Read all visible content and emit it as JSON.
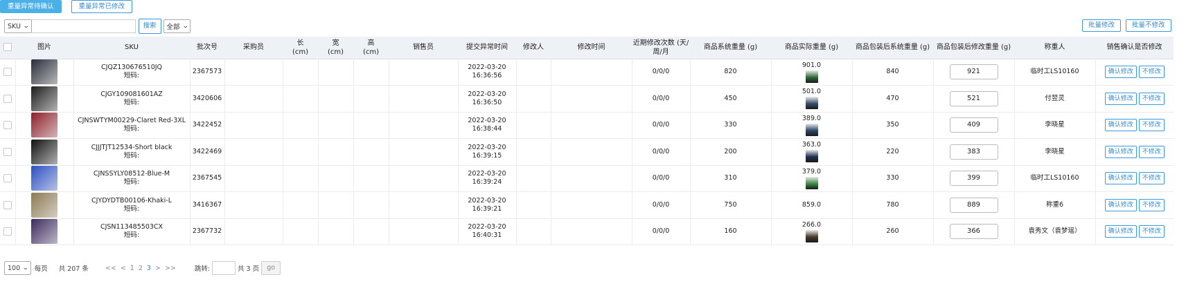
{
  "top_tabs": [
    {
      "label": "重量异常待确认"
    },
    {
      "label": "重量异常已修改"
    }
  ],
  "filter": {
    "field_select": "SKU",
    "search_value": "",
    "search_button": "搜索",
    "scope_select": "全部"
  },
  "batch": {
    "modify_label": "批量修改",
    "no_modify_label": "批量不修改"
  },
  "table": {
    "columns": [
      "",
      "图片",
      "SKU",
      "批次号",
      "采购员",
      "长\n(cm)",
      "宽\n(cm)",
      "高\n(cm)",
      "销售员",
      "提交异常时间",
      "修改人",
      "修改时间",
      "近期修改次数 (天/周/月",
      "商品系统重量 (g)",
      "商品实际重量 (g)",
      "商品包装后系统重量 (g)",
      "商品包装后修改重量 (g)",
      "称重人",
      "销售确认是否修改"
    ],
    "short_code_label": "短码:",
    "confirm_label": "确认修改",
    "reject_label": "不修改",
    "rows": [
      {
        "sku": "CJQZ130676510JQ",
        "batch": "2367573",
        "submit_date": "2022-03-20",
        "submit_time": "16:36:56",
        "recent": "0/0/0",
        "sys_weight": "820",
        "actual_weight": "901.0",
        "pkg_sys_weight": "840",
        "pkg_mod_weight": "921",
        "weigher": "临时工LS10160",
        "photo": "#2a2d3a",
        "thumb": "#2f6b3a"
      },
      {
        "sku": "CJGY109081601AZ",
        "batch": "3420606",
        "submit_date": "2022-03-20",
        "submit_time": "16:36:50",
        "recent": "0/0/0",
        "sys_weight": "450",
        "actual_weight": "501.0",
        "pkg_sys_weight": "470",
        "pkg_mod_weight": "521",
        "weigher": "付翌灵",
        "photo": "#1c1c1c",
        "thumb": "#36506e"
      },
      {
        "sku": "CJNSWTYM00229-Claret Red-3XL",
        "batch": "3422452",
        "submit_date": "2022-03-20",
        "submit_time": "16:38:44",
        "recent": "0/0/0",
        "sys_weight": "330",
        "actual_weight": "389.0",
        "pkg_sys_weight": "350",
        "pkg_mod_weight": "409",
        "weigher": "李晓星",
        "photo": "#8e1f2b",
        "thumb": "#2e4a6b"
      },
      {
        "sku": "CJJJTJT12534-Short black",
        "batch": "3422469",
        "submit_date": "2022-03-20",
        "submit_time": "16:39:15",
        "recent": "0/0/0",
        "sys_weight": "200",
        "actual_weight": "363.0",
        "pkg_sys_weight": "220",
        "pkg_mod_weight": "383",
        "weigher": "李晓星",
        "photo": "#111111",
        "thumb": "#1e3050"
      },
      {
        "sku": "CJNSSYLY08512-Blue-M",
        "batch": "2367545",
        "submit_date": "2022-03-20",
        "submit_time": "16:39:24",
        "recent": "0/0/0",
        "sys_weight": "310",
        "actual_weight": "379.0",
        "pkg_sys_weight": "330",
        "pkg_mod_weight": "399",
        "weigher": "临时工LS10160",
        "photo": "#2b4fc4",
        "thumb": "#3d8a46"
      },
      {
        "sku": "CJYDYDTB00106-Khaki-L",
        "batch": "3416367",
        "submit_date": "2022-03-20",
        "submit_time": "16:39:21",
        "recent": "0/0/0",
        "sys_weight": "750",
        "actual_weight": "859.0",
        "pkg_sys_weight": "780",
        "pkg_mod_weight": "889",
        "weigher": "称重6",
        "photo": "#8c7a52",
        "thumb": ""
      },
      {
        "sku": "CJSN113485503CX",
        "batch": "2367732",
        "submit_date": "2022-03-20",
        "submit_time": "16:40:31",
        "recent": "0/0/0",
        "sys_weight": "160",
        "actual_weight": "266.0",
        "pkg_sys_weight": "260",
        "pkg_mod_weight": "366",
        "weigher": "袁秀文（袁梦瑶）",
        "photo": "#3b2a5e",
        "thumb": "#4a3a2a"
      }
    ]
  },
  "pager": {
    "page_size": "100",
    "per_page_label": "每页",
    "total_label": "共 207 条",
    "first": "<<",
    "prev": "<",
    "pages": [
      "1",
      "2",
      "3"
    ],
    "current_page": "3",
    "next": ">",
    "last": ">>",
    "jump_label": "跳转:",
    "jump_value": "",
    "total_pages_label": "共 3 页",
    "go_label": "go"
  }
}
